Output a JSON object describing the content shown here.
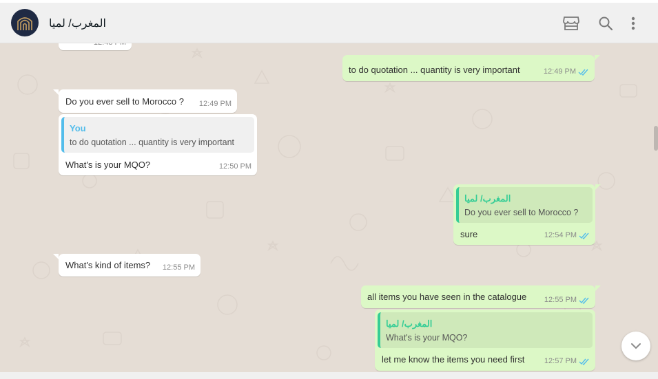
{
  "header": {
    "contact_name": "المغرب/ لميا",
    "icons": [
      "catalog-icon",
      "search-icon",
      "menu-dots-icon"
    ]
  },
  "colors": {
    "incoming": "#ffffff",
    "outgoing": "#dcf8c6",
    "quote_you": "#53bdeb",
    "quote_contact": "#35cd96",
    "read_ticks": "#53bdeb"
  },
  "messages": [
    {
      "id": "m0",
      "direction": "in",
      "time": "12:48 PM"
    },
    {
      "id": "m1",
      "direction": "out",
      "text": "to do quotation ... quantity is very important",
      "time": "12:49 PM",
      "status": "read"
    },
    {
      "id": "m2",
      "direction": "in",
      "text": "Do you ever sell to Morocco ?",
      "time": "12:49 PM"
    },
    {
      "id": "m3",
      "direction": "in",
      "quote": {
        "author": "You",
        "text": "to do quotation ... quantity is very important"
      },
      "text": "What's is your MQO?",
      "time": "12:50 PM"
    },
    {
      "id": "m4",
      "direction": "out",
      "quote": {
        "author": "المغرب/ لميا",
        "text": "Do you ever sell to Morocco ?"
      },
      "text": "sure",
      "time": "12:54 PM",
      "status": "read"
    },
    {
      "id": "m5",
      "direction": "in",
      "text": "What's kind of items?",
      "time": "12:55 PM"
    },
    {
      "id": "m6",
      "direction": "out",
      "text": "all items you have seen in the catalogue",
      "time": "12:55 PM",
      "status": "read"
    },
    {
      "id": "m7",
      "direction": "out",
      "quote": {
        "author": "المغرب/ لميا",
        "text": "What's is your MQO?"
      },
      "text": "let me know the items you need first",
      "time": "12:57 PM",
      "status": "read"
    }
  ]
}
